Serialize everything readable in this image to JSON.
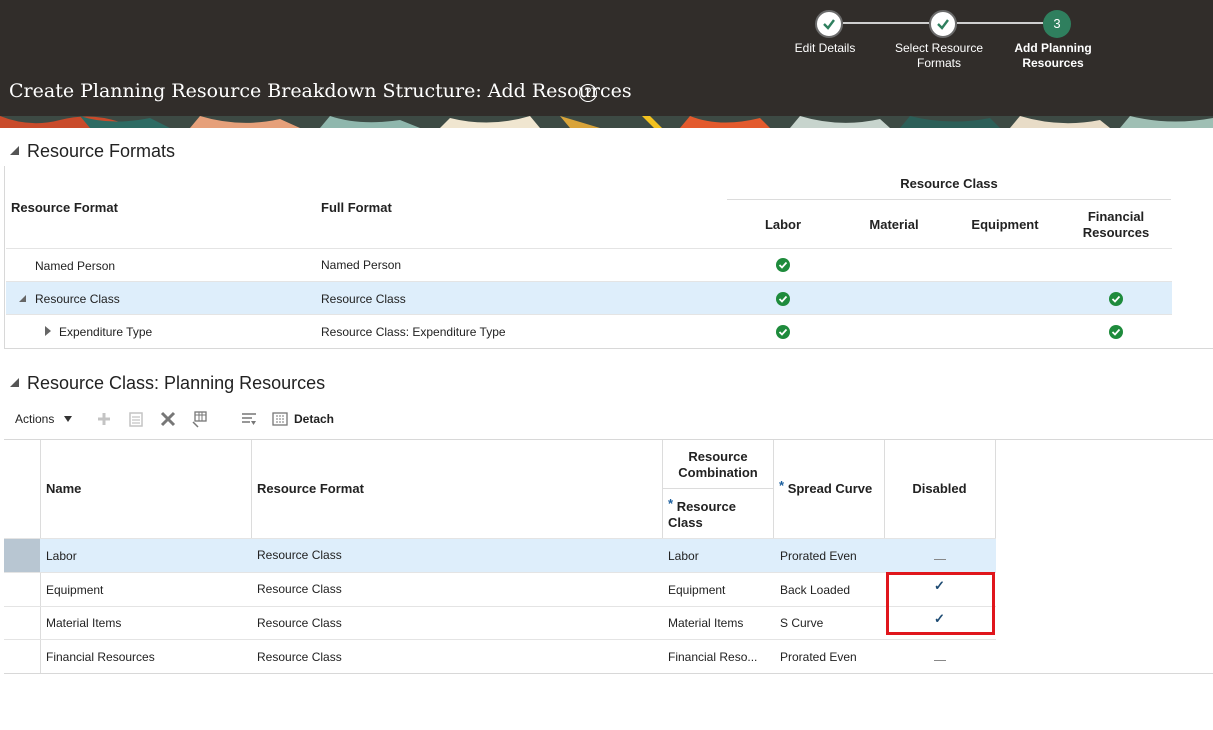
{
  "page": {
    "title": "Create Planning Resource Breakdown Structure: Add Resources",
    "help_symbol": "?"
  },
  "train": {
    "steps": [
      {
        "label": "Edit Details",
        "state": "complete"
      },
      {
        "label": "Select Resource Formats",
        "state": "complete"
      },
      {
        "label": "Add Planning Resources",
        "state": "current",
        "number": "3"
      }
    ]
  },
  "resource_formats": {
    "heading": "Resource Formats",
    "columns": {
      "resource_format": "Resource Format",
      "full_format": "Full Format",
      "group": "Resource Class",
      "labor": "Labor",
      "material": "Material",
      "equipment": "Equipment",
      "financial": "Financial Resources"
    },
    "rows": [
      {
        "resource_format": "Named Person",
        "full_format": "Named Person",
        "labor": true,
        "material": false,
        "equipment": false,
        "financial": false
      },
      {
        "resource_format": "Resource Class",
        "full_format": "Resource Class",
        "labor": true,
        "material": false,
        "equipment": false,
        "financial": true,
        "selected": true
      },
      {
        "resource_format": "Expenditure Type",
        "full_format": "Resource Class: Expenditure Type",
        "labor": true,
        "material": false,
        "equipment": false,
        "financial": true
      }
    ]
  },
  "planning_resources": {
    "heading": "Resource Class: Planning Resources",
    "toolbar": {
      "actions_label": "Actions",
      "detach_label": "Detach"
    },
    "columns": {
      "name": "Name",
      "resource_format": "Resource Format",
      "group": "Resource Combination",
      "required_mark": "*",
      "resource_class": "Resource Class",
      "spread_curve": "Spread Curve",
      "disabled": "Disabled"
    },
    "rows": [
      {
        "name": "Labor",
        "resource_format": "Resource Class",
        "resource_class": "Labor",
        "spread_curve": "Prorated Even",
        "disabled": false,
        "selected": true
      },
      {
        "name": "Equipment",
        "resource_format": "Resource Class",
        "resource_class": "Equipment",
        "spread_curve": "Back Loaded",
        "disabled": true
      },
      {
        "name": "Material Items",
        "resource_format": "Resource Class",
        "resource_class": "Material Items",
        "spread_curve": "S Curve",
        "disabled": true
      },
      {
        "name": "Financial Resources",
        "resource_format": "Resource Class",
        "resource_class": "Financial Reso...",
        "spread_curve": "Prorated Even",
        "disabled": false
      }
    ]
  },
  "colors": {
    "header_bg": "#312d2a",
    "selected_row": "#deeefb",
    "check_green": "#1e8b3c",
    "train_current": "#2f7f5e",
    "highlight": "#e0161c"
  }
}
